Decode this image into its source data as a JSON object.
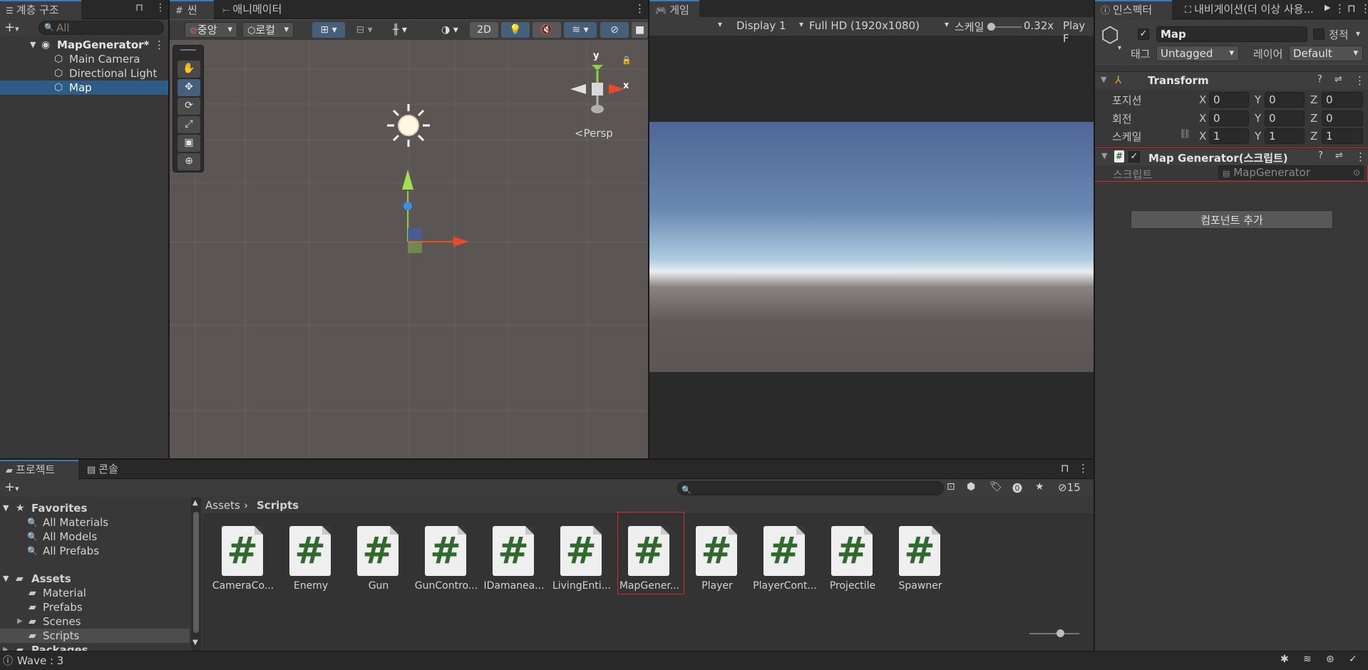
{
  "hierarchy": {
    "tab_label": "계층 구조",
    "search_placeholder": "All",
    "scene_name": "MapGenerator*",
    "items": [
      "Main Camera",
      "Directional Light",
      "Map"
    ]
  },
  "scene_view": {
    "tab_scene": "씬",
    "tab_animator": "애니메이터",
    "pivot_label": "중앙",
    "space_label": "로컬",
    "mode_2d": "2D",
    "persp_label": "Persp",
    "axis_y": "y",
    "axis_x": "x"
  },
  "game_view": {
    "tab_label": "게임",
    "display": "Display 1",
    "resolution": "Full HD (1920x1080)",
    "scale_label": "스케일",
    "scale_value": "0.32x",
    "play_label": "Play F"
  },
  "inspector": {
    "tab_label": "인스펙터",
    "tab_nav": "내비게이션(더 이상 사용...",
    "object_name": "Map",
    "static_label": "정적",
    "tag_label": "태그",
    "tag_value": "Untagged",
    "layer_label": "레이어",
    "layer_value": "Default",
    "transform": {
      "title": "Transform",
      "position_label": "포지션",
      "rotation_label": "회전",
      "scale_label": "스케일",
      "axis_x": "X",
      "axis_y": "Y",
      "axis_z": "Z",
      "position": [
        "0",
        "0",
        "0"
      ],
      "rotation": [
        "0",
        "0",
        "0"
      ],
      "scale": [
        "1",
        "1",
        "1"
      ]
    },
    "map_generator": {
      "title": "Map Generator(스크립트)",
      "script_label": "스크립트",
      "script_value": "MapGenerator"
    },
    "add_component": "컴포넌트 추가"
  },
  "project": {
    "tab_project": "프로젝트",
    "tab_console": "콘솔",
    "hidden_count": "15",
    "favorites_label": "Favorites",
    "favorites": [
      "All Materials",
      "All Models",
      "All Prefabs"
    ],
    "assets_label": "Assets",
    "folders": [
      "Material",
      "Prefabs",
      "Scenes",
      "Scripts"
    ],
    "packages_label": "Packages",
    "breadcrumb_root": "Assets",
    "breadcrumb_current": "Scripts",
    "files": [
      "CameraCo...",
      "Enemy",
      "Gun",
      "GunContro...",
      "IDamanea...",
      "LivingEnti...",
      "MapGener...",
      "Player",
      "PlayerCont...",
      "Projectile",
      "Spawner"
    ],
    "file_glyph": "#"
  },
  "status_bar": {
    "message": "Wave : 3"
  },
  "colors": {
    "selection": "#2c5d87",
    "highlight_red": "#d62a2a",
    "script_green": "#2f6a2c",
    "tab_accent": "#3a79bb"
  }
}
